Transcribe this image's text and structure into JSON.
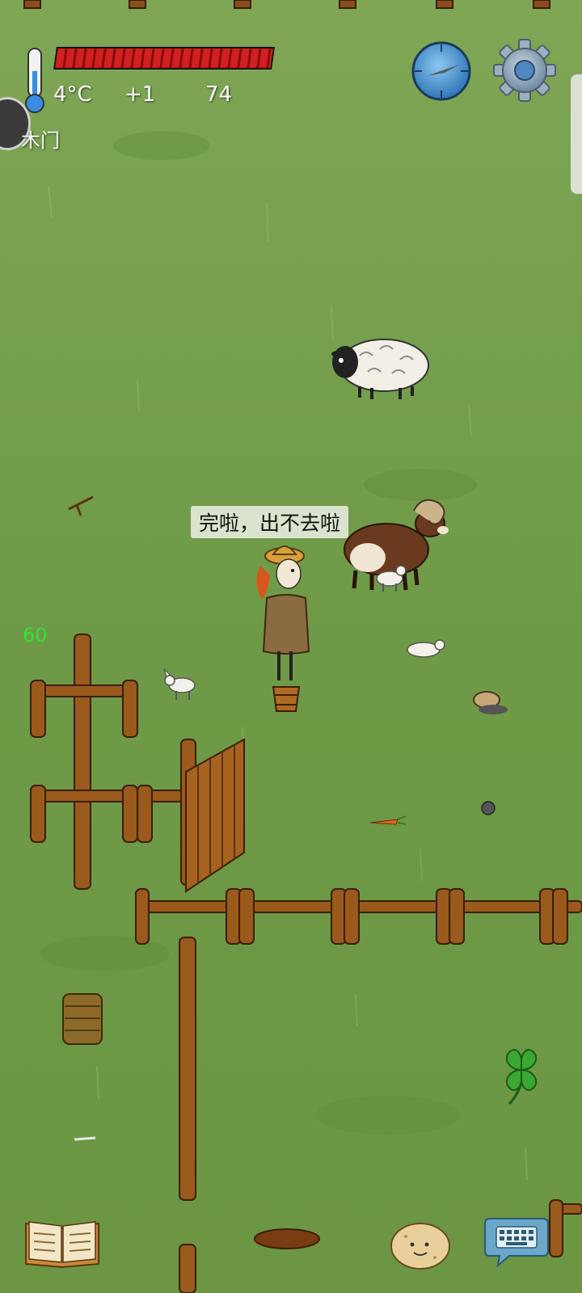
{
  "hud": {
    "temperature": "4°C",
    "temp_delta": "+1",
    "food_count": "74",
    "health_fraction": 1.0,
    "fps": "60"
  },
  "held_item_label": "木门",
  "speech_bubble": "完啦，出不去啦",
  "icons": {
    "thermometer": "thermometer-icon",
    "compass": "compass-icon",
    "settings": "gear-icon",
    "journal": "book-icon",
    "emote": "potato-face-icon",
    "chat": "keyboard-chat-icon",
    "luck": "four-leaf-clover-icon",
    "chat_head": "chat-head-icon"
  },
  "colors": {
    "grass": "#6f9a46",
    "health_bar": "#d02020",
    "fps_text": "#35e035",
    "wood": "#9a5a1c"
  }
}
